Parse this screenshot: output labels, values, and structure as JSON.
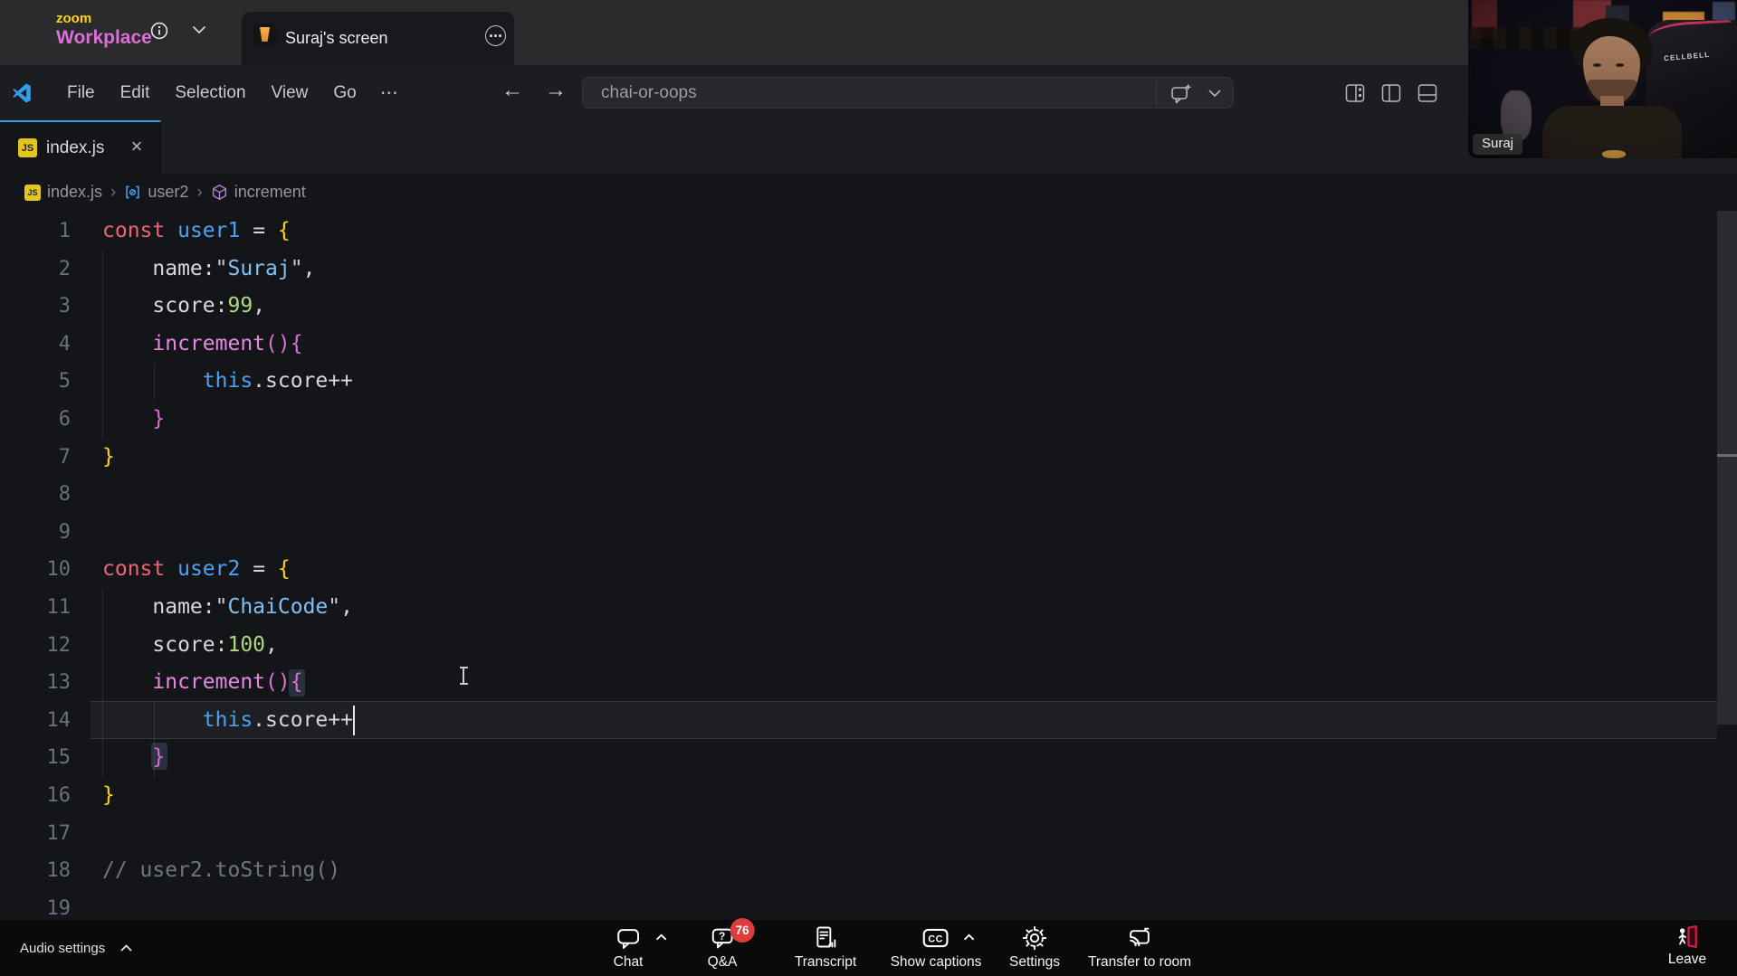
{
  "meeting": {
    "brand_top": "zoom",
    "brand_bottom": "Workplace",
    "share_tab_title": "Suraj's screen",
    "participant_name": "Suraj",
    "chair_brand": "CELLBELL"
  },
  "vscode": {
    "menu_items": [
      "File",
      "Edit",
      "Selection",
      "View",
      "Go"
    ],
    "menu_more": "⋯",
    "command_center_text": "chai-or-oops",
    "tab_file_name": "index.js",
    "js_badge": "JS",
    "close_glyph": "×",
    "breadcrumbs": [
      {
        "label": "index.js",
        "icon": "js"
      },
      {
        "label": "user2",
        "icon": "symbol-object"
      },
      {
        "label": "increment",
        "icon": "symbol-method"
      }
    ]
  },
  "editor": {
    "active_line": 14,
    "line_count": 19,
    "lines": [
      [
        [
          "kw",
          "const"
        ],
        [
          "pl",
          " "
        ],
        [
          "var",
          "user1"
        ],
        [
          "pl",
          " = "
        ],
        [
          "b1",
          "{"
        ]
      ],
      [
        [
          "pl",
          "    name:"
        ],
        [
          "q",
          "\""
        ],
        [
          "str",
          "Suraj"
        ],
        [
          "q",
          "\""
        ],
        [
          "pl",
          ","
        ]
      ],
      [
        [
          "pl",
          "    score:"
        ],
        [
          "num",
          "99"
        ],
        [
          "pl",
          ","
        ]
      ],
      [
        [
          "pl",
          "    "
        ],
        [
          "fn",
          "increment"
        ],
        [
          "b2",
          "(){"
        ]
      ],
      [
        [
          "pl",
          "        "
        ],
        [
          "th",
          "this"
        ],
        [
          "pl",
          ".score++"
        ]
      ],
      [
        [
          "pl",
          "    "
        ],
        [
          "b2",
          "}"
        ]
      ],
      [
        [
          "b1",
          "}"
        ]
      ],
      [],
      [],
      [
        [
          "kw",
          "const"
        ],
        [
          "pl",
          " "
        ],
        [
          "var",
          "user2"
        ],
        [
          "pl",
          " = "
        ],
        [
          "b1",
          "{"
        ]
      ],
      [
        [
          "pl",
          "    name:"
        ],
        [
          "q",
          "\""
        ],
        [
          "str",
          "ChaiCode"
        ],
        [
          "q",
          "\""
        ],
        [
          "pl",
          ","
        ]
      ],
      [
        [
          "pl",
          "    score:"
        ],
        [
          "num",
          "100"
        ],
        [
          "pl",
          ","
        ]
      ],
      [
        [
          "pl",
          "    "
        ],
        [
          "fn",
          "increment"
        ],
        [
          "b2",
          "(){"
        ]
      ],
      [
        [
          "pl",
          "        "
        ],
        [
          "th",
          "this"
        ],
        [
          "pl",
          ".score++"
        ]
      ],
      [
        [
          "pl",
          "    "
        ],
        [
          "b2",
          "}"
        ]
      ],
      [
        [
          "b1",
          "}"
        ]
      ],
      [],
      [
        [
          "cm",
          "// user2.toString()"
        ]
      ],
      []
    ]
  },
  "toolbar": {
    "audio_settings_label": "Audio settings",
    "buttons": [
      {
        "id": "chat",
        "label": "Chat",
        "icon": "chat",
        "chevron": true
      },
      {
        "id": "qa",
        "label": "Q&A",
        "icon": "qa",
        "badge": "76"
      },
      {
        "id": "transcript",
        "label": "Transcript",
        "icon": "transcript"
      },
      {
        "id": "captions",
        "label": "Show captions",
        "icon": "cc",
        "chevron": true
      },
      {
        "id": "settings",
        "label": "Settings",
        "icon": "gear"
      },
      {
        "id": "transfer",
        "label": "Transfer to room",
        "icon": "cast"
      }
    ],
    "leave_label": "Leave"
  },
  "colors": {
    "active_tab_accent": "#3c94ee",
    "badge_red": "#e23b3b",
    "leave_red": "#e8174a",
    "brace_gold": "#ffd602",
    "brace_orchid": "#da70d6"
  }
}
